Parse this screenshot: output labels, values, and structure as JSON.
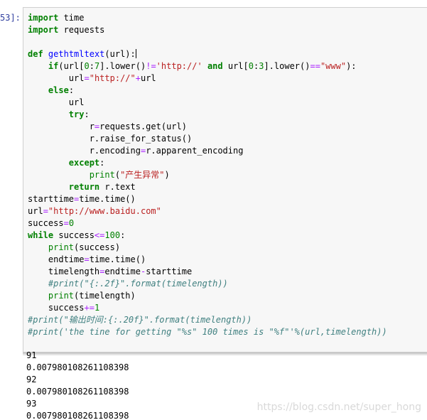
{
  "cell": {
    "prompt": "53]:",
    "code_lines": [
      [
        [
          "import",
          "kw"
        ],
        [
          " time",
          ""
        ]
      ],
      [
        [
          "import",
          "kw"
        ],
        [
          " requests",
          ""
        ]
      ],
      [],
      [
        [
          "def",
          "kw"
        ],
        [
          " ",
          ""
        ],
        [
          "gethtmltext",
          "fn"
        ],
        [
          "(url):",
          ""
        ]
      ],
      [
        [
          "    ",
          ""
        ],
        [
          "if",
          "kw"
        ],
        [
          "(url[",
          ""
        ],
        [
          "0",
          "num"
        ],
        [
          ":",
          ""
        ],
        [
          "7",
          "num"
        ],
        [
          "].lower()",
          ""
        ],
        [
          "!=",
          "op"
        ],
        [
          "'http://'",
          "str"
        ],
        [
          " ",
          ""
        ],
        [
          "and",
          "kw"
        ],
        [
          " url[",
          ""
        ],
        [
          "0",
          "num"
        ],
        [
          ":",
          ""
        ],
        [
          "3",
          "num"
        ],
        [
          "].lower()",
          ""
        ],
        [
          "==",
          "op"
        ],
        [
          "\"www\"",
          "str"
        ],
        [
          "):",
          ""
        ]
      ],
      [
        [
          "        url",
          ""
        ],
        [
          "=",
          "op"
        ],
        [
          "\"http://\"",
          "str"
        ],
        [
          "+",
          "op"
        ],
        [
          "url",
          ""
        ]
      ],
      [
        [
          "    ",
          ""
        ],
        [
          "else",
          "kw"
        ],
        [
          ":",
          ""
        ]
      ],
      [
        [
          "        url",
          ""
        ]
      ],
      [
        [
          "        ",
          ""
        ],
        [
          "try",
          "kw"
        ],
        [
          ":",
          ""
        ]
      ],
      [
        [
          "            r",
          ""
        ],
        [
          "=",
          "op"
        ],
        [
          "requests.get(url)",
          ""
        ]
      ],
      [
        [
          "            r.raise_for_status()",
          ""
        ]
      ],
      [
        [
          "            r.encoding",
          ""
        ],
        [
          "=",
          "op"
        ],
        [
          "r.apparent_encoding",
          ""
        ]
      ],
      [
        [
          "        ",
          ""
        ],
        [
          "except",
          "kw"
        ],
        [
          ":",
          ""
        ]
      ],
      [
        [
          "            ",
          ""
        ],
        [
          "print",
          "bi"
        ],
        [
          "(",
          ""
        ],
        [
          "\"产生异常\"",
          "str"
        ],
        [
          ")",
          ""
        ]
      ],
      [
        [
          "        ",
          ""
        ],
        [
          "return",
          "kw"
        ],
        [
          " r.text",
          ""
        ]
      ],
      [
        [
          "starttime",
          ""
        ],
        [
          "=",
          "op"
        ],
        [
          "time.time()",
          ""
        ]
      ],
      [
        [
          "url",
          ""
        ],
        [
          "=",
          "op"
        ],
        [
          "\"http://www.baidu.com\"",
          "str"
        ]
      ],
      [
        [
          "success",
          ""
        ],
        [
          "=",
          "op"
        ],
        [
          "0",
          "num"
        ]
      ],
      [
        [
          "while",
          "kw"
        ],
        [
          " success",
          ""
        ],
        [
          "<=",
          "op"
        ],
        [
          "100",
          "num"
        ],
        [
          ":",
          ""
        ]
      ],
      [
        [
          "    ",
          ""
        ],
        [
          "print",
          "bi"
        ],
        [
          "(success)",
          ""
        ]
      ],
      [
        [
          "    endtime",
          ""
        ],
        [
          "=",
          "op"
        ],
        [
          "time.time()",
          ""
        ]
      ],
      [
        [
          "    timelength",
          ""
        ],
        [
          "=",
          "op"
        ],
        [
          "endtime",
          ""
        ],
        [
          "-",
          "op"
        ],
        [
          "starttime",
          ""
        ]
      ],
      [
        [
          "    ",
          ""
        ],
        [
          "#print(\"{:.2f}\".format(timelength))",
          "cm"
        ]
      ],
      [
        [
          "    ",
          ""
        ],
        [
          "print",
          "bi"
        ],
        [
          "(timelength)",
          ""
        ]
      ],
      [
        [
          "    success",
          ""
        ],
        [
          "+=",
          "op"
        ],
        [
          "1",
          "num"
        ]
      ],
      [
        [
          "#print(\"输出时间:{:.20f}\".format(timelength))",
          "cm"
        ]
      ],
      [
        [
          "#print('the tine for getting \"%s\" 100 times is \"%f\"'%(url,timelength))",
          "cm"
        ]
      ]
    ],
    "colors": {
      "keyword": "#008000",
      "string": "#ba2121",
      "operator": "#aa22ff",
      "comment": "#408080",
      "function_name": "#0000ff",
      "prompt": "#303f9f",
      "cell_background": "#f7f7f7"
    }
  },
  "output": {
    "lines": [
      "91",
      "0.007980108261108398",
      "92",
      "0.007980108261108398",
      "93",
      "0.007980108261108398"
    ]
  },
  "watermark": "https://blog.csdn.net/super_hong"
}
